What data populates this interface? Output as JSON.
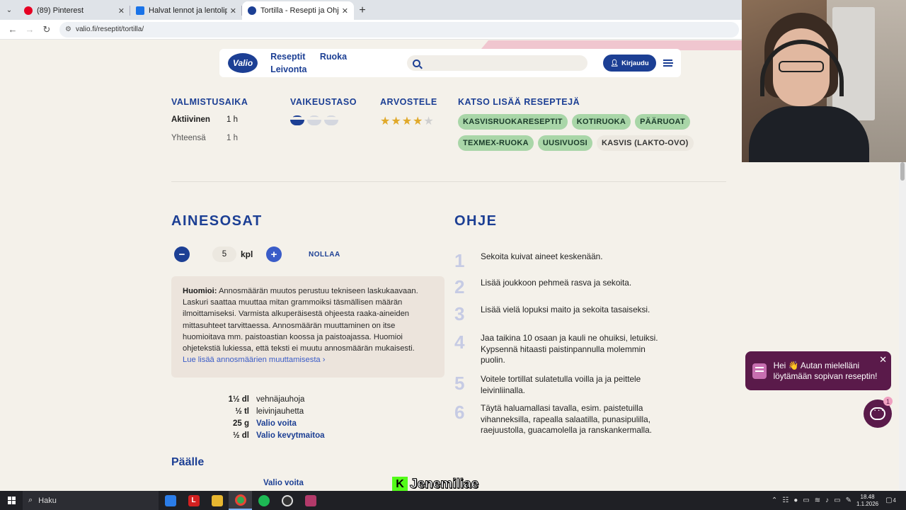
{
  "browser": {
    "tabs": [
      {
        "title": "(89) Pinterest",
        "favicon_color": "#e60023",
        "active": false
      },
      {
        "title": "Halvat lennot ja lentoliput kaikk",
        "favicon_color": "#1a73e8",
        "active": false
      },
      {
        "title": "Tortilla - Resepti ja Ohje - Valio",
        "favicon_color": "#1c3f94",
        "active": true
      }
    ],
    "new_tab_label": "+",
    "url": "valio.fi/reseptit/tortilla/"
  },
  "header": {
    "logo_text": "Valio",
    "nav": [
      "Reseptit",
      "Ruoka",
      "Leivonta"
    ],
    "search_placeholder": "",
    "login_label": "Kirjaudu"
  },
  "meta": {
    "prep_heading": "VALMISTUSAIKA",
    "active_label": "Aktiivinen",
    "active_value": "1 h",
    "total_label": "Yhteensä",
    "total_value": "1 h",
    "difficulty_heading": "VAIKEUSTASO",
    "difficulty_level": 1,
    "difficulty_max": 3,
    "rate_heading": "ARVOSTELE",
    "rating": 4,
    "rating_max": 5,
    "more_heading": "KATSO LISÄÄ RESEPTEJÄ",
    "tags": [
      {
        "label": "KASVISRUOKARESEPTIT",
        "style": "green"
      },
      {
        "label": "KOTIRUOKA",
        "style": "green"
      },
      {
        "label": "PÄÄRUOAT",
        "style": "green"
      },
      {
        "label": "TEXMEX-RUOKA",
        "style": "green"
      },
      {
        "label": "UUSIVUOSI",
        "style": "green"
      },
      {
        "label": "KASVIS (LAKTO-OVO)",
        "style": "plain"
      }
    ]
  },
  "ingredients": {
    "heading": "AINESOSAT",
    "portion_count": "5",
    "portion_unit": "kpl",
    "reset_label": "NOLLAA",
    "note_bold": "Huomioi:",
    "note_text": " Annosmäärän muutos perustuu tekniseen laskukaavaan. Laskuri saattaa muuttaa mitan grammoiksi täsmällisen määrän ilmoittamiseksi. Varmista alkuperäisestä ohjeesta raaka-aineiden mittasuhteet tarvittaessa. Annosmäärän muuttaminen on itse huomioitava mm. paistoastian koossa ja paistoajassa. Huomioi ohjetekstiä lukiessa, että teksti ei muutu annosmäärän mukaisesti.",
    "note_link": "Lue lisää annosmäärien muuttamisesta ›",
    "items": [
      {
        "amount": "1½ dl",
        "name": "vehnäjauhoja",
        "link": false
      },
      {
        "amount": "½ tl",
        "name": "leivinjauhetta",
        "link": false
      },
      {
        "amount": "25 g",
        "name": "Valio voita",
        "link": true
      },
      {
        "amount": "½ dl",
        "name": "Valio kevytmaitoa",
        "link": true
      }
    ],
    "topping_heading": "Päälle",
    "topping_item": "Valio voita"
  },
  "instructions": {
    "heading": "OHJE",
    "steps": [
      {
        "num": "1",
        "text": "Sekoita kuivat aineet keskenään."
      },
      {
        "num": "2",
        "text": "Lisää joukkoon pehmeä rasva ja sekoita."
      },
      {
        "num": "3",
        "text": "Lisää vielä lopuksi maito ja sekoita tasaiseksi."
      },
      {
        "num": "4",
        "text": "Jaa taikina 10 osaan ja kauli ne ohuiksi, letuiksi. Kypsennä hitaasti paistinpannulla molemmin puolin."
      },
      {
        "num": "5",
        "text": "Voitele tortillat sulatetulla voilla ja ja peittele leivinliinalla."
      },
      {
        "num": "6",
        "text": "Täytä haluamallasi tavalla, esim. paistetuilla vihanneksilla, rapealla salaatilla, punasipulilla, raejuustolla, guacamolella ja ranskankermalla."
      }
    ]
  },
  "chat": {
    "message": "Hei 👋 Autan mielelläni löytämään sopivan reseptin!",
    "badge": "1"
  },
  "overlay": {
    "streamer_logo": "K",
    "streamer_name": "Jenemiliae"
  },
  "taskbar": {
    "search_label": "Haku",
    "time": "18.48",
    "date": "1.1.2026",
    "notification_count": "4"
  },
  "colors": {
    "brand_blue": "#1c3f94",
    "tag_green": "#a9d6a8",
    "chat_purple": "#5a1a4a"
  }
}
